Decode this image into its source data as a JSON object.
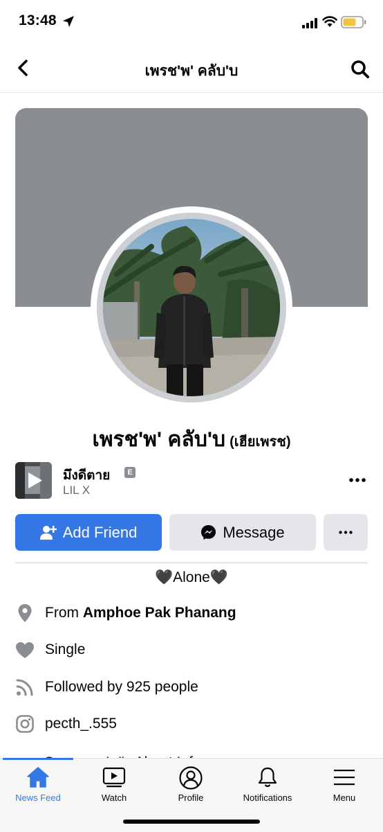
{
  "status_bar": {
    "time": "13:48"
  },
  "nav": {
    "title": "เพรช'พ' คลับ'บ"
  },
  "profile": {
    "name": "เพรช'พ' คลับ'บ",
    "alternate_name": "(เฮียเพรช)"
  },
  "music": {
    "title": "มึงดีตาย",
    "explicit_badge": "E",
    "artist": "LIL X"
  },
  "actions": {
    "add_friend": "Add Friend",
    "message": "Message"
  },
  "bio": "🖤Alone🖤",
  "info": {
    "from_prefix": "From",
    "from_place": "Amphoe Pak Phanang",
    "relationship": "Single",
    "followers": "Followed by 925 people",
    "instagram": "pecth_.555",
    "see_about": "See เพรช'พ''s About Info"
  },
  "tabs": [
    {
      "label": "News Feed",
      "icon": "home-icon",
      "active": true
    },
    {
      "label": "Watch",
      "icon": "watch-icon",
      "active": false
    },
    {
      "label": "Profile",
      "icon": "profile-icon",
      "active": false
    },
    {
      "label": "Notifications",
      "icon": "bell-icon",
      "active": false
    },
    {
      "label": "Menu",
      "icon": "menu-icon",
      "active": false
    }
  ],
  "colors": {
    "accent": "#3578e5",
    "cover": "#8a8d91",
    "secondary_button": "#e4e6eb",
    "muted_text": "#65676b"
  }
}
